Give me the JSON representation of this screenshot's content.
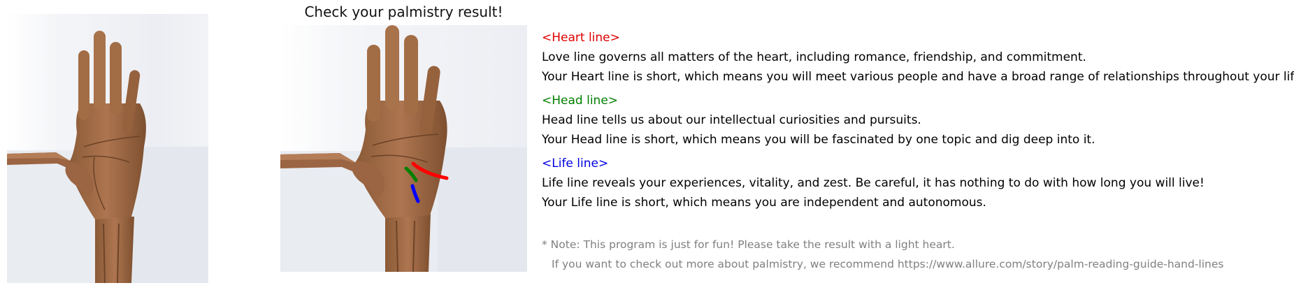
{
  "page": {
    "title": "Check your palmistry result!"
  },
  "images": {
    "original": "hand-photo",
    "annotated": "hand-photo-with-palm-lines"
  },
  "sections": [
    {
      "heading": "<Heart line>",
      "color": "#e00000",
      "line1": "Love line governs all matters of the heart, including romance, friendship, and commitment.",
      "line2": "Your Heart line is short, which means you will meet various people and have a broad range of relationships throughout your life."
    },
    {
      "heading": "<Head line>",
      "color": "#007f00",
      "line1": "Head line tells us about our intellectual curiosities and pursuits.",
      "line2": "Your Head line is short, which means you will be fascinated by one topic and dig deep into it."
    },
    {
      "heading": "<Life line>",
      "color": "#0000e0",
      "line1": "Life line reveals your experiences, vitality, and zest. Be careful, it has nothing to do with how long you will live!",
      "line2": "Your Life line is short, which means you are independent and autonomous."
    }
  ],
  "note": {
    "line1": "* Note: This program is just for fun! Please take the result with a light heart.",
    "line2": "If you want to check out more about palmistry, we recommend https://www.allure.com/story/palm-reading-guide-hand-lines"
  },
  "colors": {
    "heart_line": "#e00000",
    "head_line": "#007f00",
    "life_line": "#0000e0",
    "note_text": "#808080",
    "skin": "#a26d45"
  }
}
